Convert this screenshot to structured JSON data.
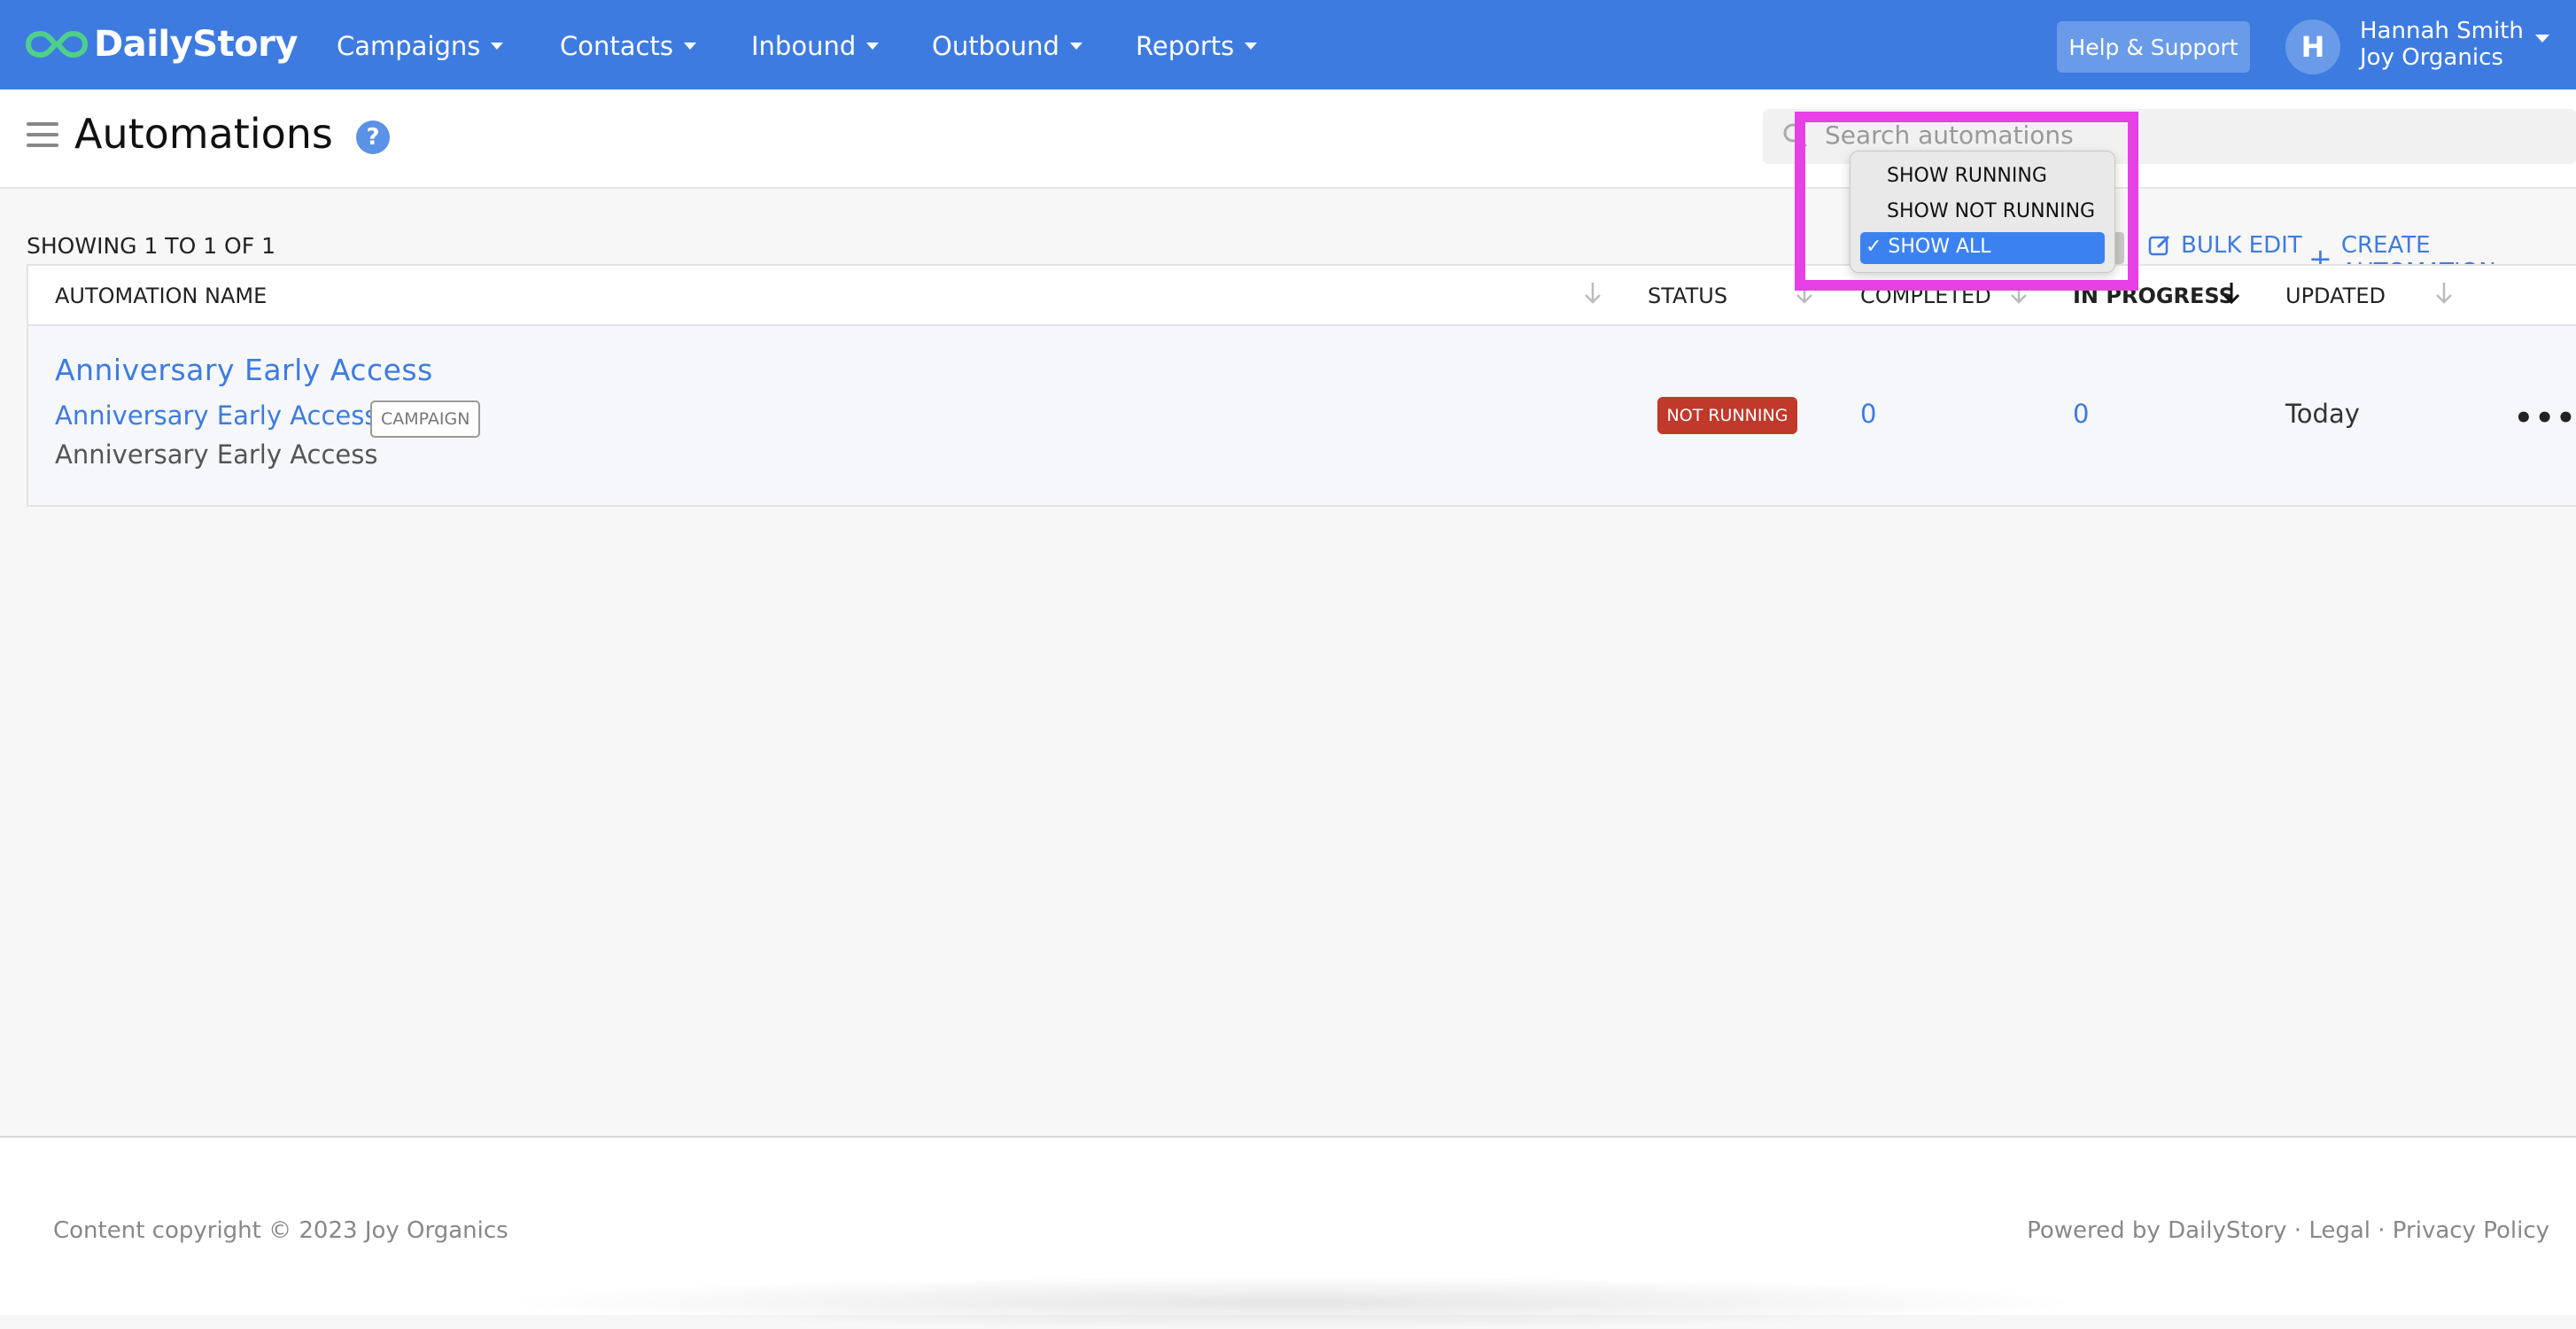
{
  "brand": {
    "name": "DailyStory",
    "accent": "#3e7be0"
  },
  "nav": [
    {
      "label": "Campaigns"
    },
    {
      "label": "Contacts"
    },
    {
      "label": "Inbound"
    },
    {
      "label": "Outbound"
    },
    {
      "label": "Reports"
    }
  ],
  "header": {
    "help_label": "Help & Support",
    "avatar_initial": "H",
    "user_name": "Hannah Smith",
    "user_org": "Joy Organics"
  },
  "page": {
    "title": "Automations",
    "help_icon": "?",
    "search_placeholder": "Search automations",
    "showing": "SHOWING 1 TO 1 OF 1",
    "bulk_edit": "BULK EDIT",
    "create_automation": "CREATE AUTOMATION"
  },
  "filter_menu": {
    "options": [
      "SHOW RUNNING",
      "SHOW NOT RUNNING",
      "SHOW ALL"
    ],
    "selected_label": "✓ SHOW ALL"
  },
  "table": {
    "columns": [
      "AUTOMATION NAME",
      "STATUS",
      "COMPLETED",
      "IN PROGRESS",
      "UPDATED"
    ],
    "rows": [
      {
        "title": "Anniversary Early Access",
        "campaign": "Anniversary Early Access",
        "badge": "CAMPAIGN",
        "description": "Anniversary Early Access",
        "status": "NOT RUNNING",
        "status_color": "#c0392b",
        "completed": "0",
        "in_progress": "0",
        "updated": "Today",
        "more": "•••"
      }
    ]
  },
  "footer": {
    "copyright": "Content copyright © 2023 Joy Organics",
    "powered": "Powered by DailyStory · Legal · Privacy Policy"
  },
  "highlight_color": "#e640e6"
}
